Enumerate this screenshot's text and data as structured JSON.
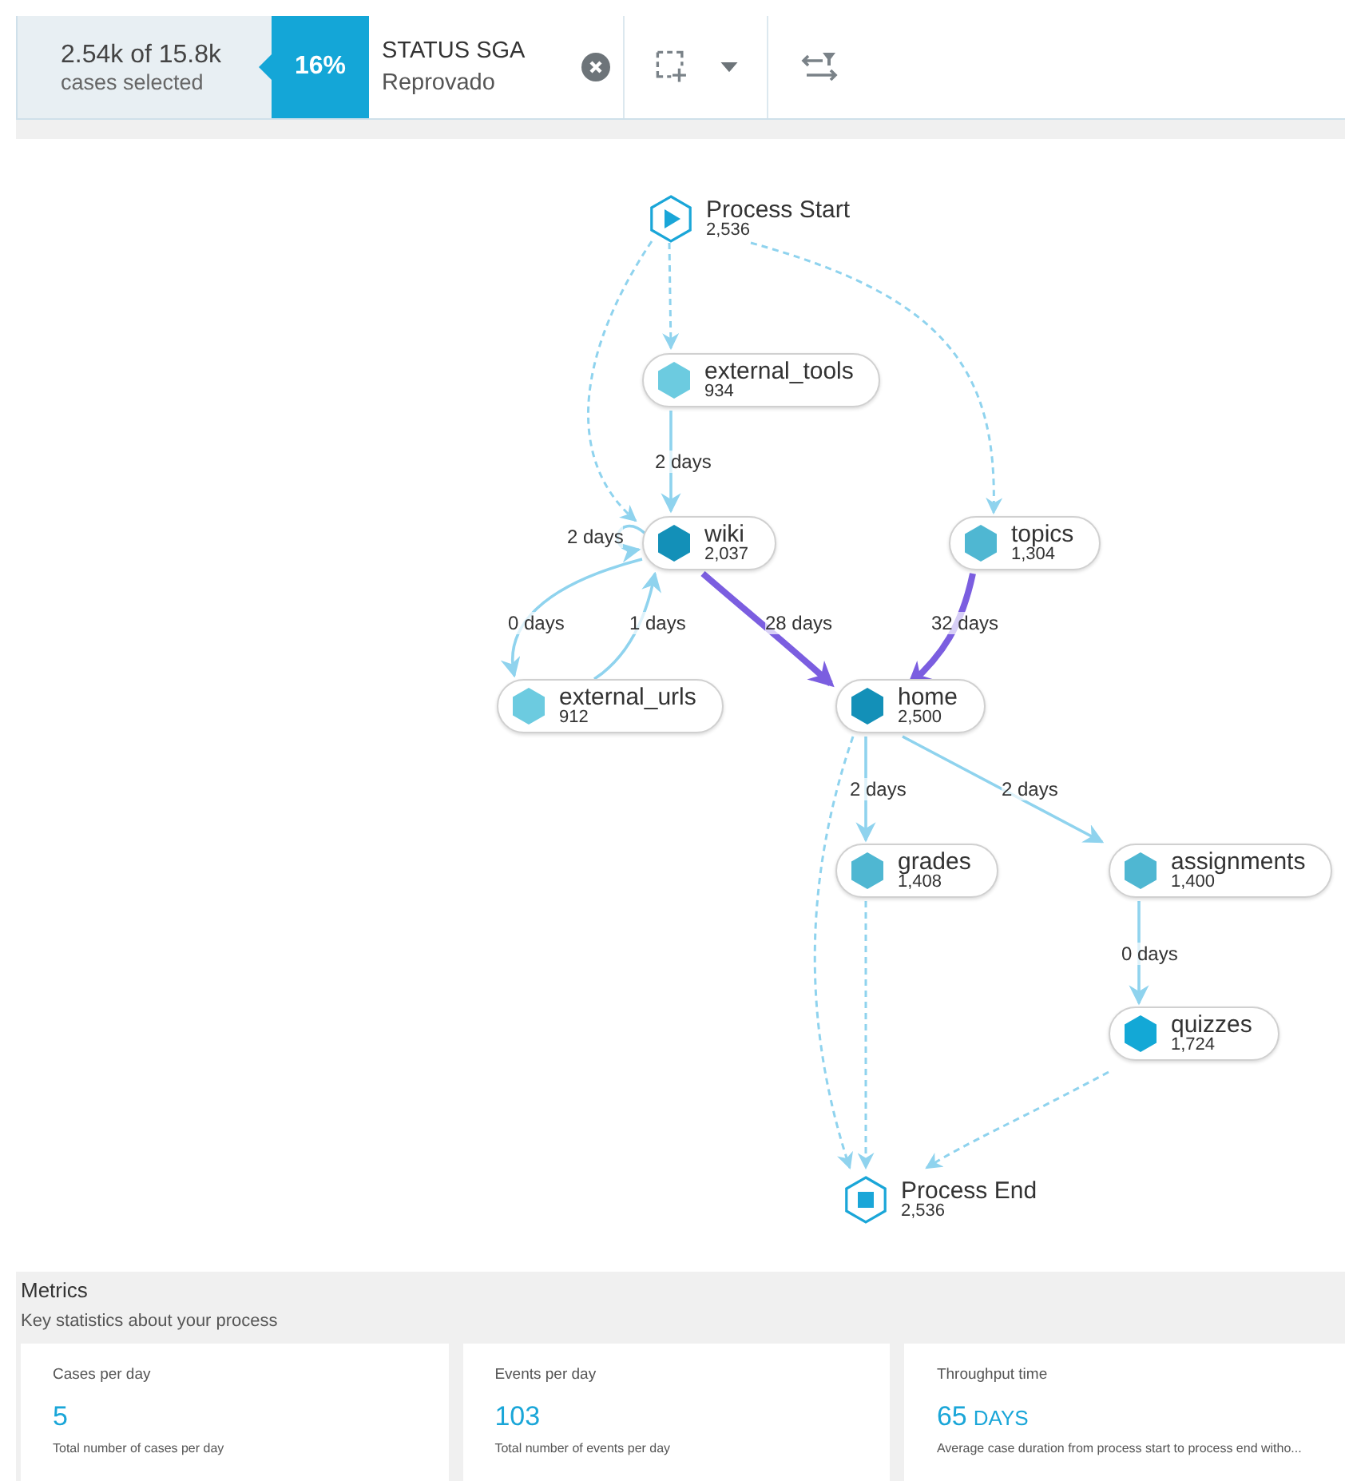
{
  "selection": {
    "count": "2.54k of 15.8k",
    "caption": "cases selected",
    "percent": "16%"
  },
  "filter": {
    "name": "STATUS SGA",
    "value": "Reprovado"
  },
  "process_map": {
    "nodes": [
      {
        "kind": "start",
        "label": "Process Start",
        "count": "2,536"
      },
      {
        "kind": "activity",
        "label": "external_tools",
        "count": "934",
        "color": "#6ccbe0"
      },
      {
        "kind": "activity",
        "label": "wiki",
        "count": "2,037",
        "color": "#1390b8"
      },
      {
        "kind": "activity",
        "label": "topics",
        "count": "1,304",
        "color": "#4fb7d2"
      },
      {
        "kind": "activity",
        "label": "external_urls",
        "count": "912",
        "color": "#6ccbe0"
      },
      {
        "kind": "activity",
        "label": "home",
        "count": "2,500",
        "color": "#1390b8"
      },
      {
        "kind": "activity",
        "label": "grades",
        "count": "1,408",
        "color": "#4fb7d2"
      },
      {
        "kind": "activity",
        "label": "assignments",
        "count": "1,400",
        "color": "#4fb7d2"
      },
      {
        "kind": "activity",
        "label": "quizzes",
        "count": "1,724",
        "color": "#13a8d6"
      },
      {
        "kind": "end",
        "label": "Process End",
        "count": "2,536"
      }
    ],
    "edges": [
      {
        "kind": "dashed"
      },
      {
        "kind": "dashed"
      },
      {
        "kind": "dashed"
      },
      {
        "kind": "solid",
        "label": "2 days"
      },
      {
        "kind": "solid",
        "label": "2 days"
      },
      {
        "kind": "solid",
        "label": "0 days"
      },
      {
        "kind": "solid",
        "label": "1 days"
      },
      {
        "kind": "bottleneck",
        "label": "28 days"
      },
      {
        "kind": "bottleneck",
        "label": "32 days"
      },
      {
        "kind": "solid",
        "label": "2 days"
      },
      {
        "kind": "solid",
        "label": "2 days"
      },
      {
        "kind": "dashed"
      },
      {
        "kind": "dashed"
      },
      {
        "kind": "solid",
        "label": "0 days"
      },
      {
        "kind": "dashed"
      }
    ]
  },
  "metrics": {
    "title": "Metrics",
    "subtitle": "Key statistics about your process",
    "cards": [
      {
        "title": "Cases per day",
        "value": "5",
        "description": "Total number of cases per day"
      },
      {
        "title": "Events per day",
        "value": "103",
        "description": "Total number of events per day"
      },
      {
        "title": "Throughput time",
        "value": "65",
        "unit": "DAYS",
        "description": "Average case duration from process start to process end witho..."
      }
    ]
  }
}
